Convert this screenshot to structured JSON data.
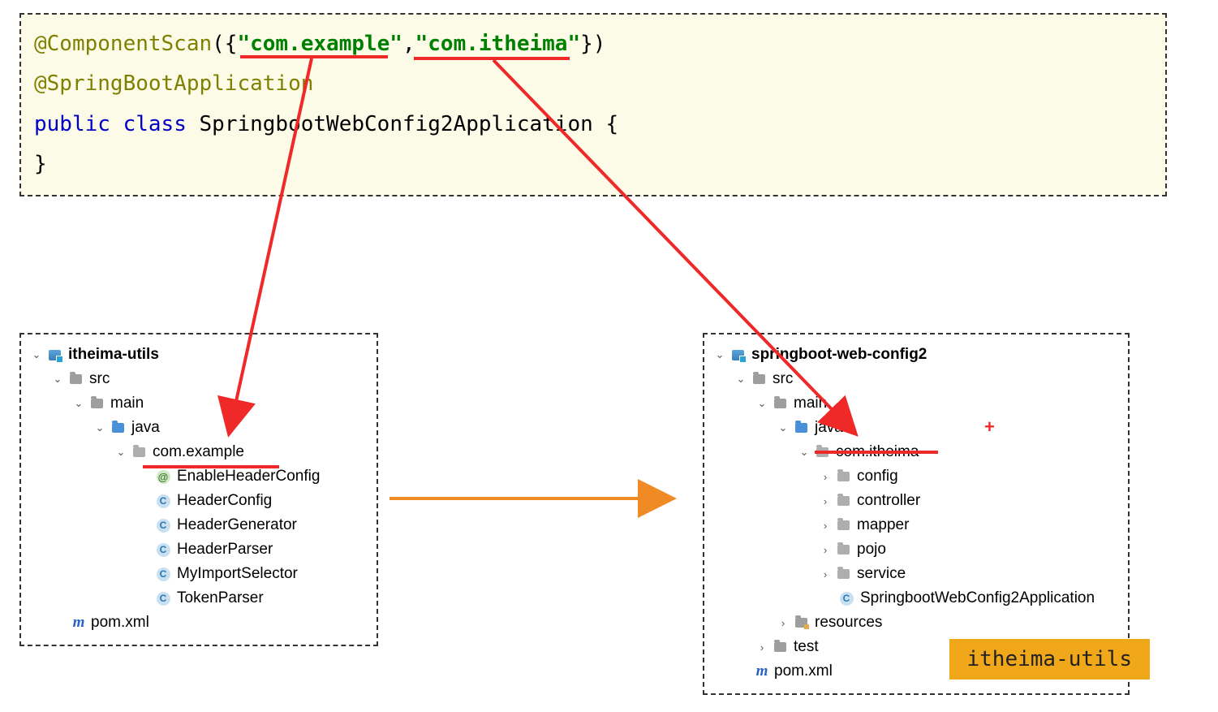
{
  "code": {
    "anno1": "@ComponentScan",
    "p1": "({",
    "str1": "\"com.example\"",
    "comma": ",",
    "str2": "\"com.itheima\"",
    "p2": "})",
    "anno2": "@SpringBootApplication",
    "kw1": "public",
    "kw2": "class",
    "cls": "SpringbootWebConfig2Application",
    "brace_open": "{",
    "brace_close": "}"
  },
  "left_tree": {
    "root": "itheima-utils",
    "src": "src",
    "main": "main",
    "java": "java",
    "pkg": "com.example",
    "files": [
      "EnableHeaderConfig",
      "HeaderConfig",
      "HeaderGenerator",
      "HeaderParser",
      "MyImportSelector",
      "TokenParser"
    ],
    "pom": "pom.xml"
  },
  "right_tree": {
    "root": "springboot-web-config2",
    "src": "src",
    "main": "main",
    "java": "java",
    "pkg": "com.itheima",
    "subpkgs": [
      "config",
      "controller",
      "mapper",
      "pojo",
      "service"
    ],
    "app": "SpringbootWebConfig2Application",
    "resources": "resources",
    "test": "test",
    "pom": "pom.xml"
  },
  "badge": "itheima-utils",
  "chev_open": "⌄",
  "chev_closed": "›",
  "icon_c": "C",
  "icon_at": "@",
  "icon_m": "m",
  "red_plus": "+"
}
